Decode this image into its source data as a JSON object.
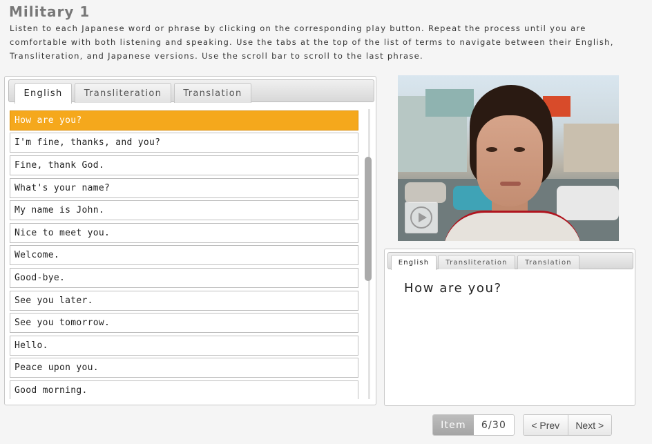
{
  "page": {
    "title": "Military 1",
    "instructions": "Listen to each Japanese word or phrase by clicking on the corresponding play button. Repeat the process until you are comfortable with both listening and speaking. Use the tabs at the top of the list of terms to navigate between their English, Transliteration, and Japanese versions. Use the scroll bar to scroll to the last phrase."
  },
  "list_panel": {
    "tabs": [
      {
        "label": "English",
        "active": true
      },
      {
        "label": "Transliteration",
        "active": false
      },
      {
        "label": "Translation",
        "active": false
      }
    ],
    "phrases": [
      "How are you?",
      "I'm fine, thanks, and you?",
      "Fine, thank God.",
      "What's your name?",
      "My name is John.",
      "Nice to meet you.",
      "Welcome.",
      "Good-bye.",
      "See you later.",
      "See you tomorrow.",
      "Hello.",
      "Peace upon you.",
      "Good morning."
    ],
    "selected_index": 0
  },
  "video": {
    "play_icon": "play-circle-icon"
  },
  "display_panel": {
    "tabs": [
      {
        "label": "English",
        "active": true
      },
      {
        "label": "Transliteration",
        "active": false
      },
      {
        "label": "Translation",
        "active": false
      }
    ],
    "text": "How are you?"
  },
  "pager": {
    "label": "Item",
    "count": "6/30",
    "prev_label": "< Prev",
    "next_label": "Next >"
  },
  "colors": {
    "selected": "#f5a81c",
    "background": "#f5f5f5"
  }
}
